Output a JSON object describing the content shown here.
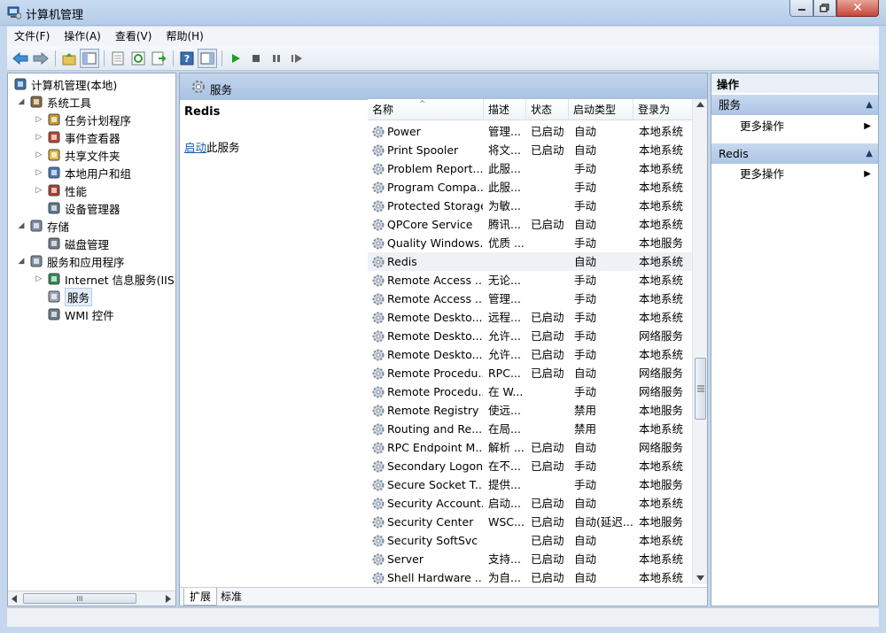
{
  "window": {
    "title": "计算机管理"
  },
  "menu": [
    "文件(F)",
    "操作(A)",
    "查看(V)",
    "帮助(H)"
  ],
  "tree": [
    {
      "label": "计算机管理(本地)",
      "level": 0,
      "arrow": "",
      "icon": "computer-icon"
    },
    {
      "label": "系统工具",
      "level": 1,
      "arrow": "◢",
      "icon": "tools-icon"
    },
    {
      "label": "任务计划程序",
      "level": 2,
      "arrow": "▷",
      "icon": "clock-icon"
    },
    {
      "label": "事件查看器",
      "level": 2,
      "arrow": "▷",
      "icon": "event-viewer-icon"
    },
    {
      "label": "共享文件夹",
      "level": 2,
      "arrow": "▷",
      "icon": "shared-folder-icon"
    },
    {
      "label": "本地用户和组",
      "level": 2,
      "arrow": "▷",
      "icon": "users-icon"
    },
    {
      "label": "性能",
      "level": 2,
      "arrow": "▷",
      "icon": "performance-icon"
    },
    {
      "label": "设备管理器",
      "level": 2,
      "arrow": "",
      "icon": "device-manager-icon"
    },
    {
      "label": "存储",
      "level": 1,
      "arrow": "◢",
      "icon": "storage-icon"
    },
    {
      "label": "磁盘管理",
      "level": 2,
      "arrow": "",
      "icon": "disk-icon"
    },
    {
      "label": "服务和应用程序",
      "level": 1,
      "arrow": "◢",
      "icon": "services-apps-icon"
    },
    {
      "label": "Internet 信息服务(IIS)管",
      "level": 2,
      "arrow": "▷",
      "icon": "iis-icon"
    },
    {
      "label": "服务",
      "level": 2,
      "arrow": "",
      "icon": "gear-icon",
      "selected": true
    },
    {
      "label": "WMI 控件",
      "level": 2,
      "arrow": "",
      "icon": "wmi-icon"
    }
  ],
  "left_scroll_label": "III",
  "center": {
    "header_title": "服务",
    "selected_service": "Redis",
    "start_link": "启动",
    "start_suffix": "此服务"
  },
  "columns": [
    "名称",
    "描述",
    "状态",
    "启动类型",
    "登录为"
  ],
  "services": [
    [
      "Power",
      "管理...",
      "已启动",
      "自动",
      "本地系统"
    ],
    [
      "Print Spooler",
      "将文...",
      "已启动",
      "自动",
      "本地系统"
    ],
    [
      "Problem Report...",
      "此服...",
      "",
      "手动",
      "本地系统"
    ],
    [
      "Program Compa...",
      "此服...",
      "",
      "手动",
      "本地系统"
    ],
    [
      "Protected Storage",
      "为敏...",
      "",
      "手动",
      "本地系统"
    ],
    [
      "QPCore Service",
      "腾讯...",
      "已启动",
      "自动",
      "本地系统"
    ],
    [
      "Quality Windows...",
      "优质 ...",
      "",
      "手动",
      "本地服务"
    ],
    [
      "Redis",
      "",
      "",
      "自动",
      "本地系统"
    ],
    [
      "Remote Access ...",
      "无论...",
      "",
      "手动",
      "本地系统"
    ],
    [
      "Remote Access ...",
      "管理...",
      "",
      "手动",
      "本地系统"
    ],
    [
      "Remote Deskto...",
      "远程...",
      "已启动",
      "手动",
      "本地系统"
    ],
    [
      "Remote Deskto...",
      "允许...",
      "已启动",
      "手动",
      "网络服务"
    ],
    [
      "Remote Deskto...",
      "允许...",
      "已启动",
      "手动",
      "本地系统"
    ],
    [
      "Remote Procedu...",
      "RPC...",
      "已启动",
      "自动",
      "网络服务"
    ],
    [
      "Remote Procedu...",
      "在 W...",
      "",
      "手动",
      "网络服务"
    ],
    [
      "Remote Registry",
      "使远...",
      "",
      "禁用",
      "本地服务"
    ],
    [
      "Routing and Re...",
      "在局...",
      "",
      "禁用",
      "本地系统"
    ],
    [
      "RPC Endpoint M...",
      "解析 ...",
      "已启动",
      "自动",
      "网络服务"
    ],
    [
      "Secondary Logon",
      "在不...",
      "已启动",
      "手动",
      "本地系统"
    ],
    [
      "Secure Socket T...",
      "提供...",
      "",
      "手动",
      "本地服务"
    ],
    [
      "Security Account...",
      "启动...",
      "已启动",
      "自动",
      "本地系统"
    ],
    [
      "Security Center",
      "WSC...",
      "已启动",
      "自动(延迟...",
      "本地服务"
    ],
    [
      "Security SoftSvc",
      "",
      "已启动",
      "自动",
      "本地系统"
    ],
    [
      "Server",
      "支持...",
      "已启动",
      "自动",
      "本地系统"
    ],
    [
      "Shell Hardware ...",
      "为自...",
      "已启动",
      "自动",
      "本地系统"
    ]
  ],
  "highlight_row": 7,
  "tabs": [
    "扩展",
    "标准"
  ],
  "actions": {
    "header": "操作",
    "sections": [
      {
        "title": "服务",
        "item": "更多操作"
      },
      {
        "title": "Redis",
        "item": "更多操作"
      }
    ]
  }
}
